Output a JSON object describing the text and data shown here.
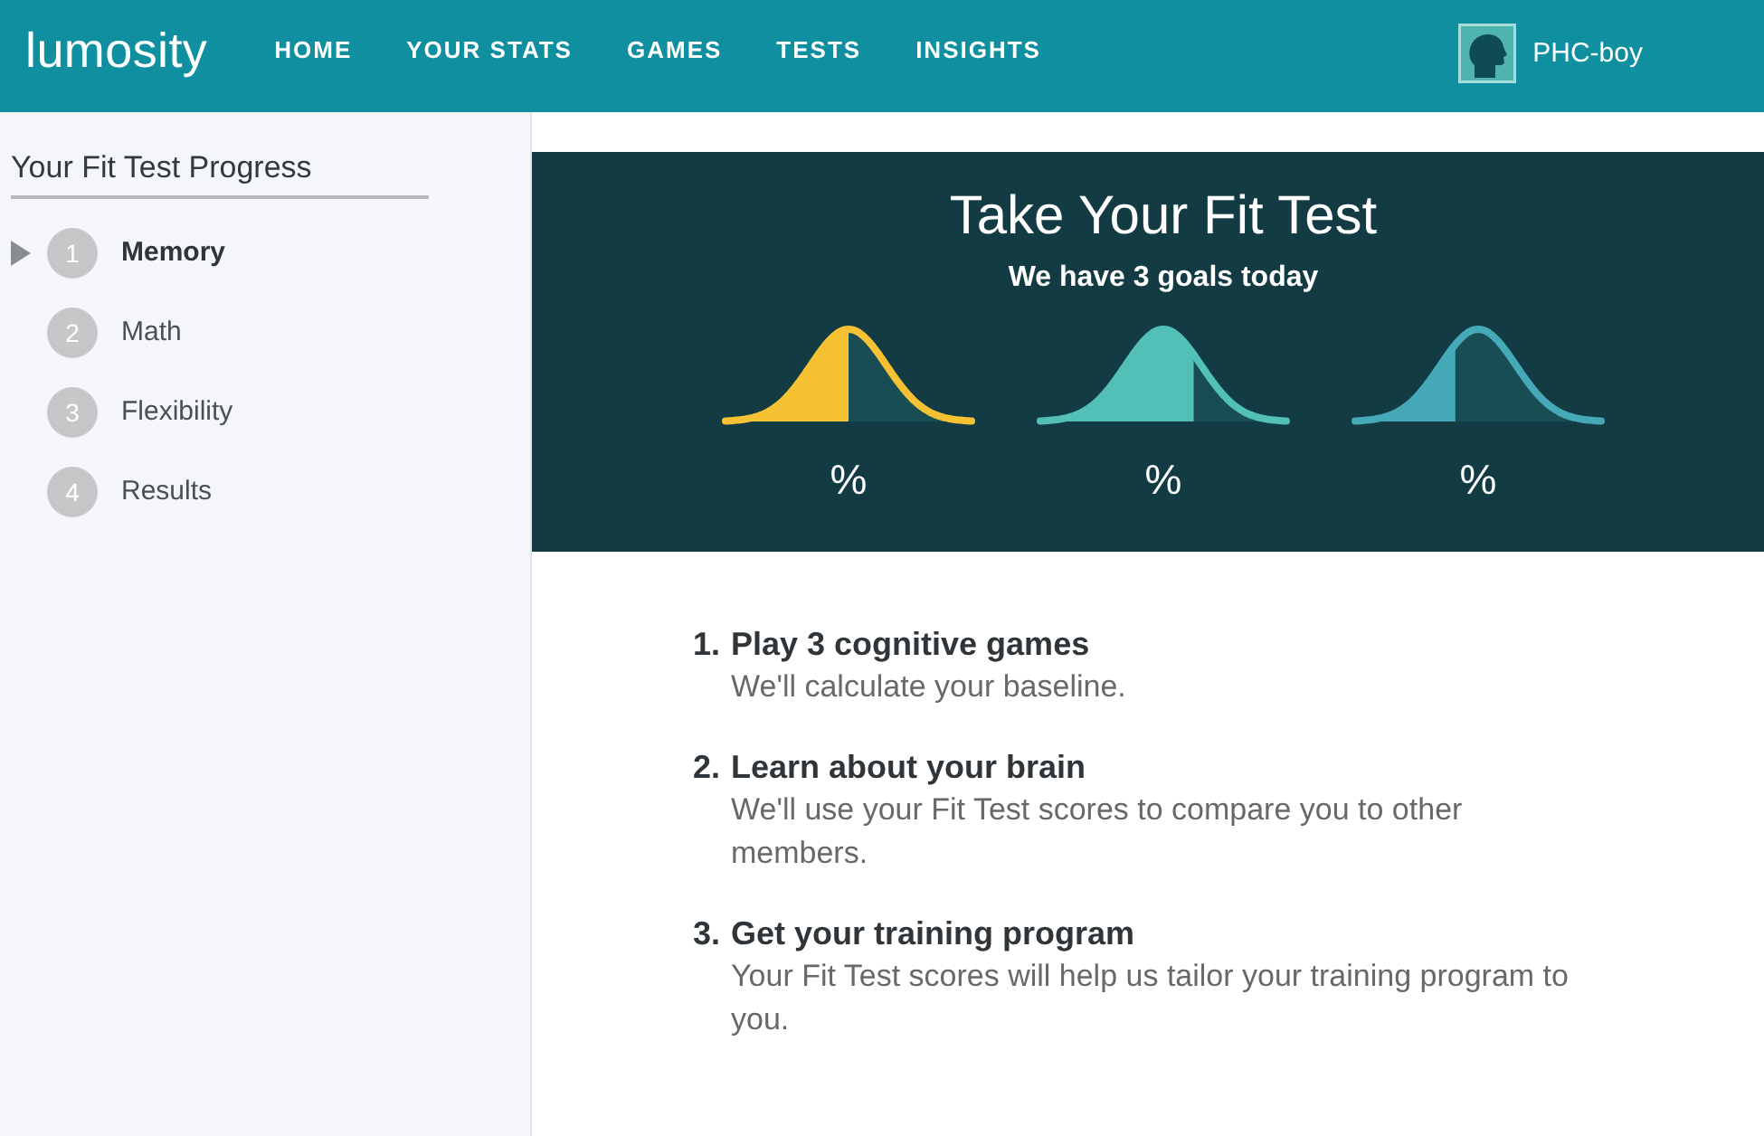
{
  "header": {
    "logo": "lumosity",
    "nav": [
      "HOME",
      "YOUR STATS",
      "GAMES",
      "TESTS",
      "INSIGHTS"
    ],
    "user": {
      "name": "PHC-boy"
    }
  },
  "sidebar": {
    "title": "Your Fit Test Progress",
    "steps": [
      {
        "number": "1",
        "label": "Memory",
        "selected": true
      },
      {
        "number": "2",
        "label": "Math",
        "selected": false
      },
      {
        "number": "3",
        "label": "Flexibility",
        "selected": false
      },
      {
        "number": "4",
        "label": "Results",
        "selected": false
      }
    ]
  },
  "hero": {
    "title": "Take Your Fit Test",
    "subtitle": "We have 3 goals today",
    "goals": [
      {
        "color": "#f6c233",
        "level": 0.5,
        "percent": "%"
      },
      {
        "color": "#52c0b6",
        "level": 0.62,
        "percent": "%"
      },
      {
        "color": "#45a9b8",
        "level": 0.41,
        "percent": "%"
      }
    ]
  },
  "steps": [
    {
      "number": "1.",
      "title": "Play 3 cognitive games",
      "description": "We'll calculate your baseline."
    },
    {
      "number": "2.",
      "title": "Learn about your brain",
      "description": "We'll use your Fit Test scores to compare you to other members."
    },
    {
      "number": "3.",
      "title": "Get your training program",
      "description": "Your Fit Test scores will help us tailor your training program to you."
    }
  ]
}
